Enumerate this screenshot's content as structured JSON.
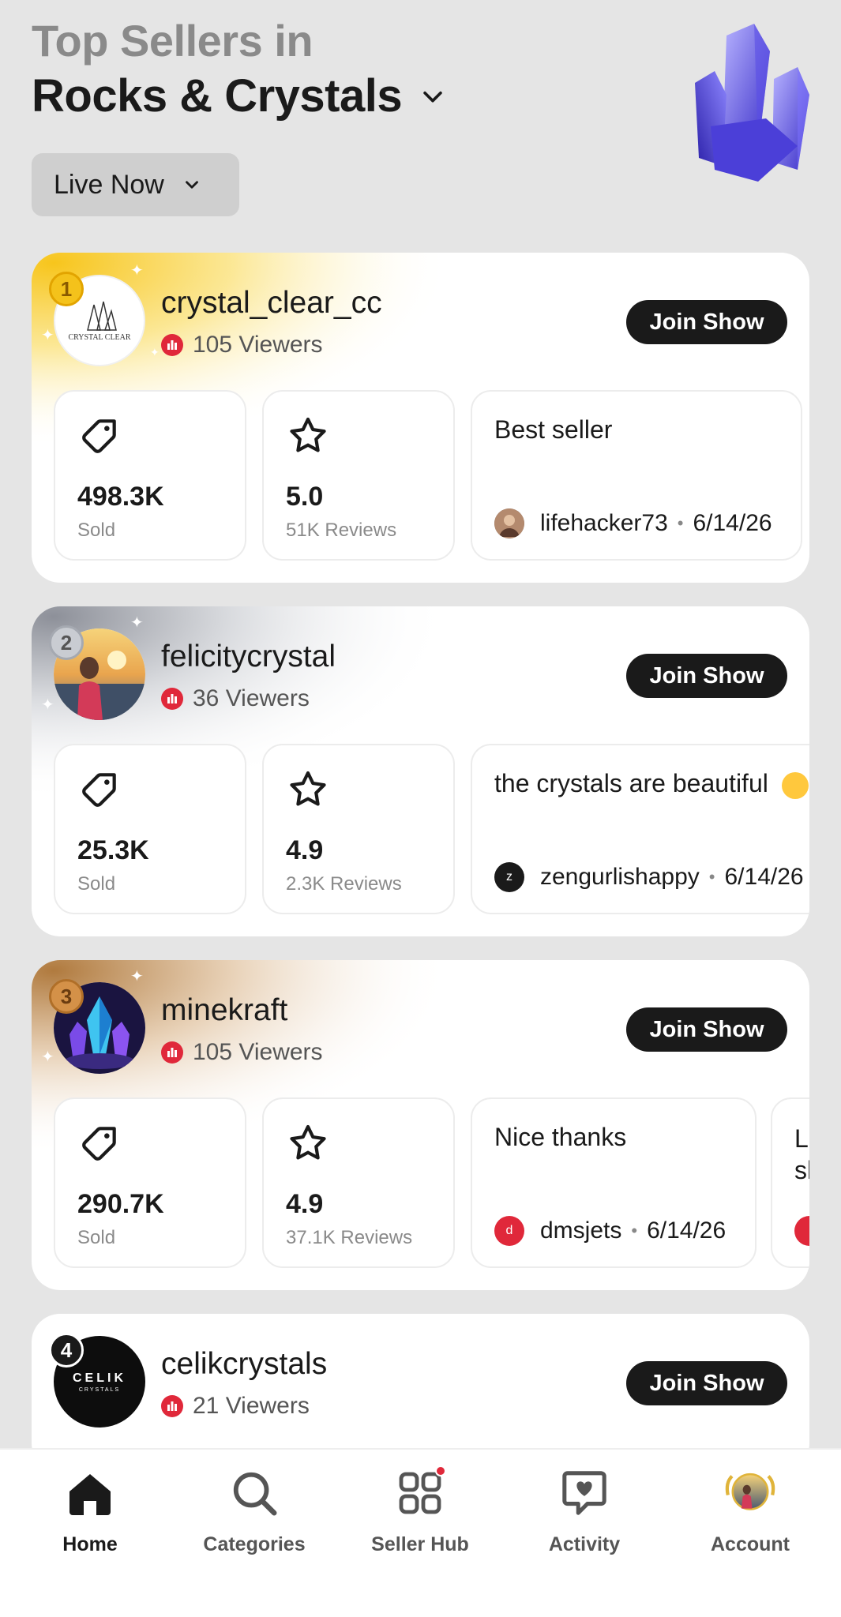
{
  "header": {
    "subtitle": "Top Sellers in",
    "category": "Rocks & Crystals",
    "filter_label": "Live Now"
  },
  "colors": {
    "live_red": "#e0283a",
    "gold": "#f4c21b",
    "silver": "#b8bcc4",
    "bronze": "#c98a3a",
    "button_dark": "#1a1a1a"
  },
  "sellers": [
    {
      "rank": "1",
      "name": "crystal_clear_cc",
      "avatar_text": "CRYSTAL CLEAR",
      "viewers": "105 Viewers",
      "join_label": "Join Show",
      "sold_value": "498.3K",
      "sold_label": "Sold",
      "rating_value": "5.0",
      "rating_label": "51K Reviews",
      "review_text": "Best seller",
      "review_user": "lifehacker73",
      "review_date": "6/14/26"
    },
    {
      "rank": "2",
      "name": "felicitycrystal",
      "viewers": "36 Viewers",
      "join_label": "Join Show",
      "sold_value": "25.3K",
      "sold_label": "Sold",
      "rating_value": "4.9",
      "rating_label": "2.3K Reviews",
      "review_text": "the crystals are beautiful",
      "review_user": "zengurlishappy",
      "review_user_initial": "z",
      "review_date": "6/14/26"
    },
    {
      "rank": "3",
      "name": "minekraft",
      "viewers": "105 Viewers",
      "join_label": "Join Show",
      "sold_value": "290.7K",
      "sold_label": "Sold",
      "rating_value": "4.9",
      "rating_label": "37.1K Reviews",
      "review_text": "Nice thanks",
      "review_user": "dmsjets",
      "review_user_initial": "d",
      "review_date": "6/14/26",
      "next_review_peek": "Le",
      "next_review_peek2": "sl"
    },
    {
      "rank": "4",
      "name": "celikcrystals",
      "avatar_text": "CELIK",
      "avatar_subtext": "CRYSTALS",
      "viewers": "21 Viewers",
      "join_label": "Join Show"
    }
  ],
  "nav": {
    "home": "Home",
    "categories": "Categories",
    "seller_hub": "Seller Hub",
    "activity": "Activity",
    "account": "Account"
  }
}
